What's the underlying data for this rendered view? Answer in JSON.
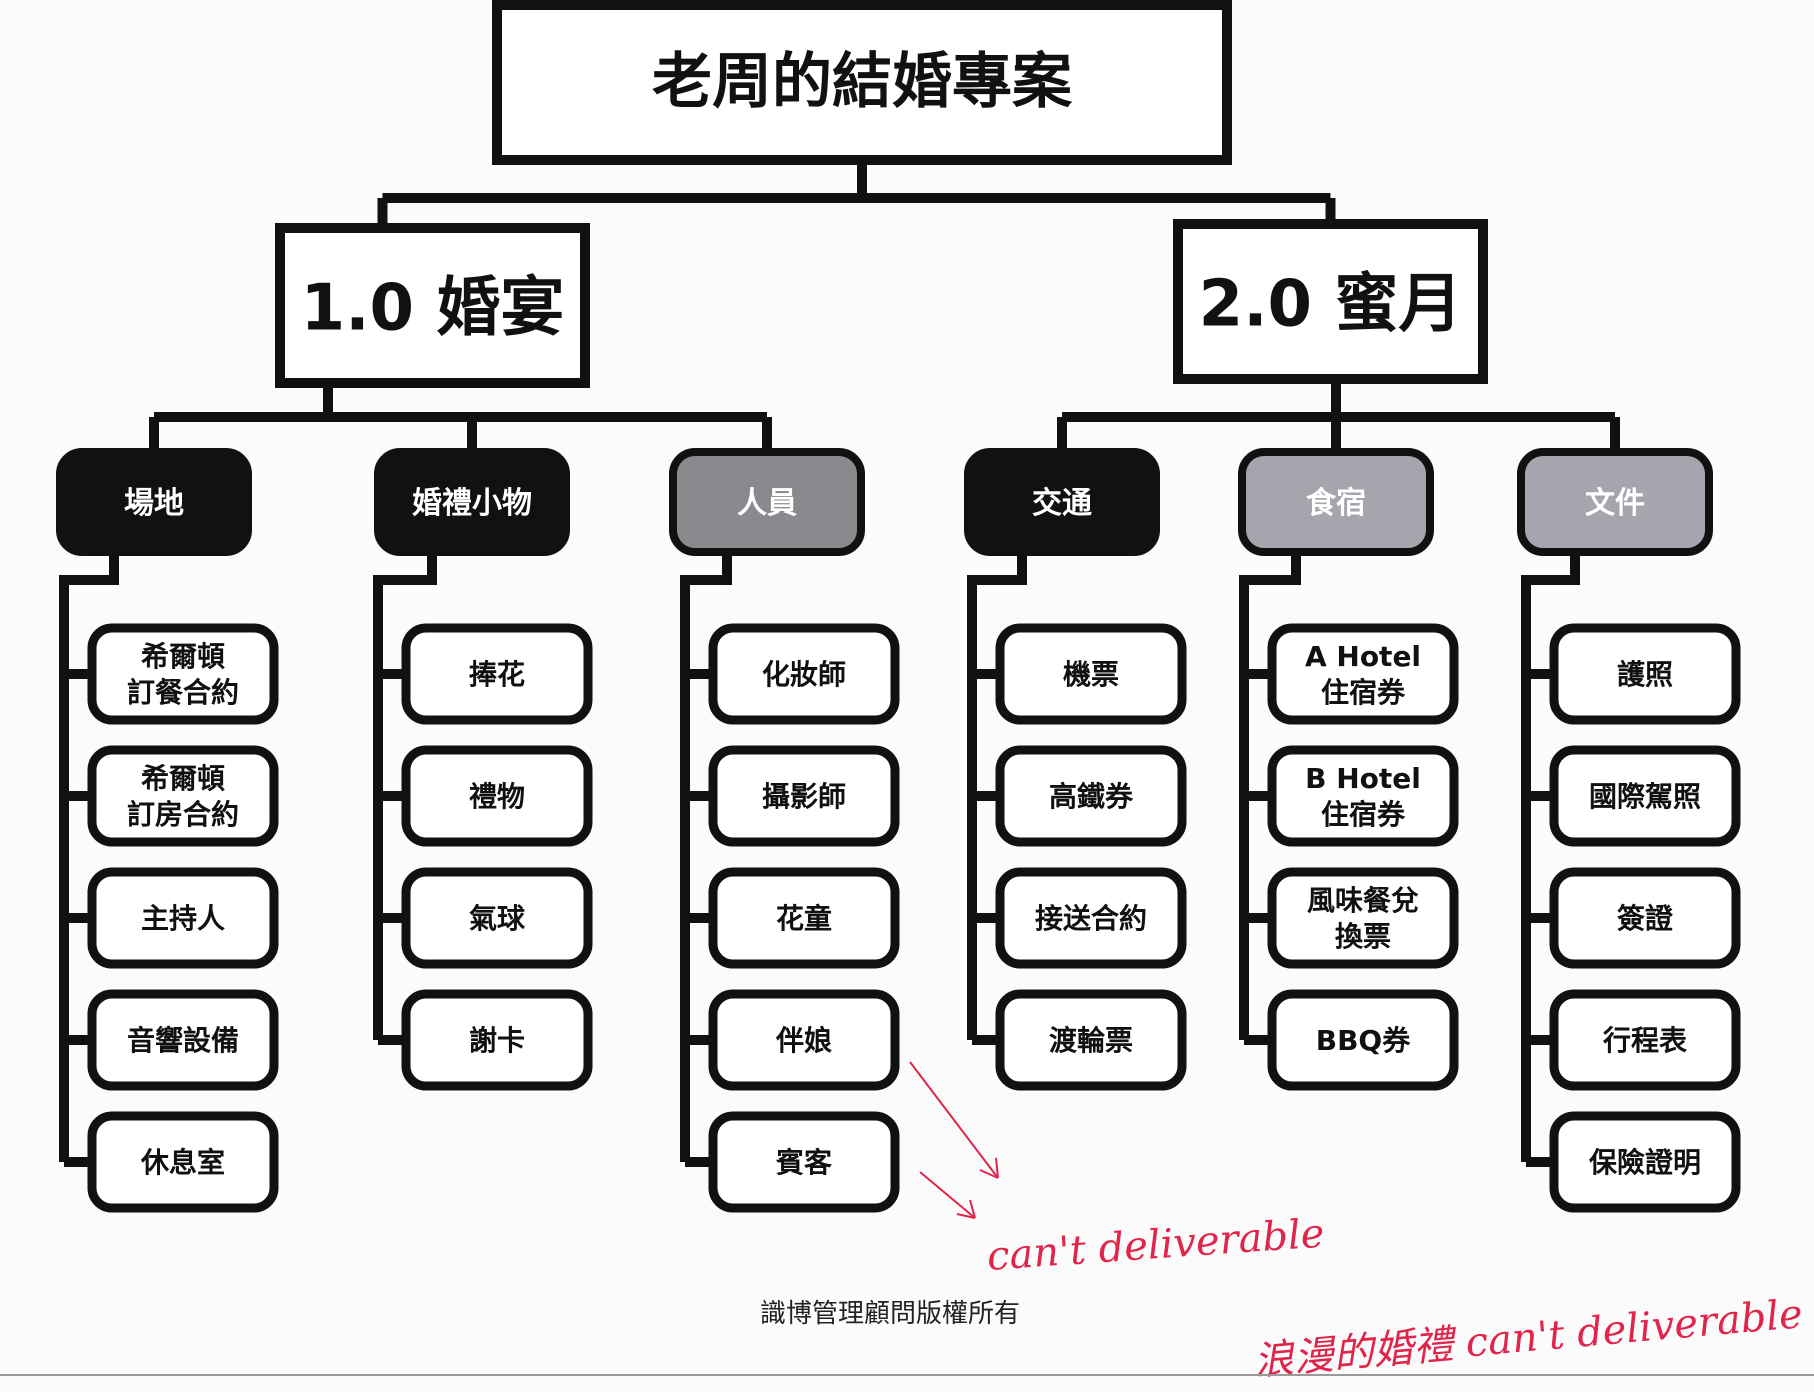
{
  "title": "老周的結婚專案",
  "colors": {
    "line": "#111111",
    "node_fill": "#ffffff",
    "cat_black": "#111111",
    "cat_grey": "#8a8a8e",
    "cat_light_grey": "#a5a5ad",
    "cat_text": "#ffffff",
    "page_bg": "#fbfbfb",
    "annotation": "#e0244a"
  },
  "branches": [
    {
      "label": "1.0 婚宴",
      "categories": [
        {
          "label": "場地",
          "tone": "cat_black",
          "items": [
            [
              "希爾頓",
              "訂餐合約"
            ],
            [
              "希爾頓",
              "訂房合約"
            ],
            [
              "主持人"
            ],
            [
              "音響設備"
            ],
            [
              "休息室"
            ]
          ]
        },
        {
          "label": "婚禮小物",
          "tone": "cat_black",
          "items": [
            [
              "捧花"
            ],
            [
              "禮物"
            ],
            [
              "氣球"
            ],
            [
              "謝卡"
            ]
          ]
        },
        {
          "label": "人員",
          "tone": "cat_grey",
          "items": [
            [
              "化妝師"
            ],
            [
              "攝影師"
            ],
            [
              "花童"
            ],
            [
              "伴娘"
            ],
            [
              "賓客"
            ]
          ]
        }
      ]
    },
    {
      "label": "2.0 蜜月",
      "categories": [
        {
          "label": "交通",
          "tone": "cat_black",
          "items": [
            [
              "機票"
            ],
            [
              "高鐵券"
            ],
            [
              "接送合約"
            ],
            [
              "渡輪票"
            ]
          ]
        },
        {
          "label": "食宿",
          "tone": "cat_light_grey",
          "items": [
            [
              "A Hotel",
              "住宿券"
            ],
            [
              "B Hotel",
              "住宿券"
            ],
            [
              "風味餐兌",
              "換票"
            ],
            [
              "BBQ券"
            ]
          ]
        },
        {
          "label": "文件",
          "tone": "cat_light_grey",
          "items": [
            [
              "護照"
            ],
            [
              "國際駕照"
            ],
            [
              "簽證"
            ],
            [
              "行程表"
            ],
            [
              "保險證明"
            ]
          ]
        }
      ]
    }
  ],
  "footer": "識博管理顧問版權所有",
  "annotations": {
    "arrow_note": "can't deliverable",
    "bottom_note": "浪漫的婚禮 can't deliverable"
  }
}
